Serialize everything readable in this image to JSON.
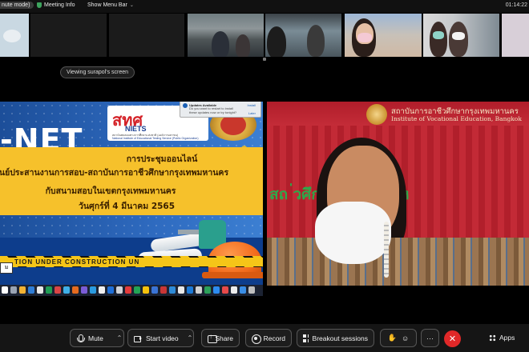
{
  "topbar": {
    "mode_label": "nute mode)",
    "meeting_info_label": "Meeting Info",
    "show_menu_bar_label": "Show Menu Bar",
    "clock": "01:14:22"
  },
  "viewing_label": "Viewing surapol's screen",
  "shared_screen": {
    "headline": "-NET",
    "logo_text": "สทศ",
    "logo_sub": "NIETS",
    "logo_fine_1": "สถาบันทดสอบทางการศึกษาแห่งชาติ (องค์การมหาชน)",
    "logo_fine_2": "National Institute of Educational Testing Service (Public Organization)",
    "banner_line_1": "การประชุมออนไลน์",
    "banner_line_2": "นย์ประสานงานการสอบ-สถาบันการอาชีวศึกษากรุงเทพมหานคร",
    "banner_line_3": "กับสนามสอบในเขตกรุงเทพมหานคร",
    "banner_line_4": "วันศุกร์ที่ 4 มีนาคม 2565",
    "tape_text": "TION      UNDER CONSTRUCTION      UN",
    "tape_label": "ม",
    "notification": {
      "title": "Updates Available",
      "body": "Do you want to restart to install these updates now or try tonight?",
      "btn_install": "Install",
      "btn_later": "Later"
    }
  },
  "speaker": {
    "sign_th": "สถาบันการอาชีวศึกษากรุงเทพมหานคร",
    "sign_en": "Institute of Vocational Education, Bangkok",
    "sign_green": "สถ                 ่วศึกษากรุงเทพมห"
  },
  "controls": {
    "mute_label": "Mute",
    "start_video_label": "Start video",
    "share_label": "Share",
    "record_label": "Record",
    "breakout_label": "Breakout sessions",
    "more_label": "···",
    "end_label": "✕",
    "apps_label": "Apps"
  },
  "colors": {
    "end_button": "#e02828",
    "banner": "#f6c12b",
    "background": "#000000"
  }
}
